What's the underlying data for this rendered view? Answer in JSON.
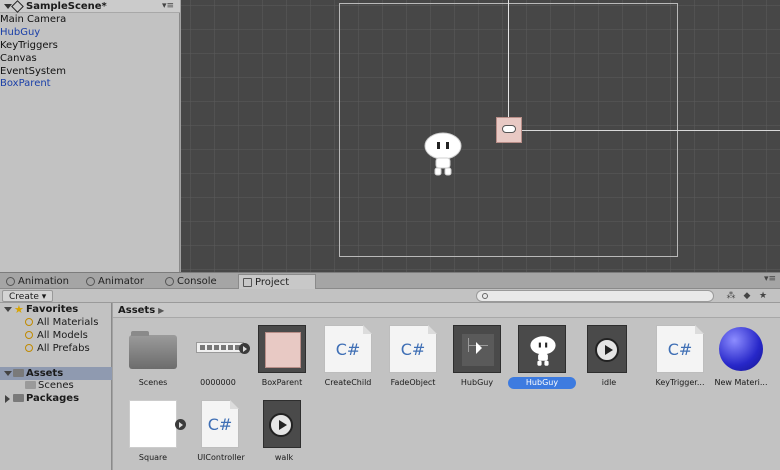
{
  "hierarchy": {
    "scene_name": "SampleScene*",
    "items": [
      {
        "label": "Main Camera",
        "prefab": false
      },
      {
        "label": "HubGuy",
        "prefab": true
      },
      {
        "label": "KeyTriggers",
        "prefab": false
      },
      {
        "label": "Canvas",
        "prefab": false,
        "collapsed": true
      },
      {
        "label": "EventSystem",
        "prefab": false
      },
      {
        "label": "BoxParent",
        "prefab": true
      }
    ]
  },
  "tabs": [
    {
      "label": "Animation",
      "icon": "animation-icon"
    },
    {
      "label": "Animator",
      "icon": "animator-icon"
    },
    {
      "label": "Console",
      "icon": "console-icon"
    },
    {
      "label": "Project",
      "icon": "project-folder-icon",
      "active": true
    }
  ],
  "toolbar": {
    "create_label": "Create",
    "search_value": ""
  },
  "project_sidebar": {
    "favorites_label": "Favorites",
    "favorites": [
      "All Materials",
      "All Models",
      "All Prefabs"
    ],
    "assets_label": "Assets",
    "assets_children": [
      "Scenes"
    ],
    "packages_label": "Packages"
  },
  "breadcrumb": "Assets",
  "assets": [
    {
      "label": "Scenes",
      "kind": "folder"
    },
    {
      "label": "0000000",
      "kind": "animation"
    },
    {
      "label": "BoxParent",
      "kind": "prefab-box"
    },
    {
      "label": "CreateChild",
      "kind": "script"
    },
    {
      "label": "FadeObject",
      "kind": "script"
    },
    {
      "label": "HubGuy",
      "kind": "screen"
    },
    {
      "label": "HubGuy",
      "kind": "sprite",
      "selected": true
    },
    {
      "label": "idle",
      "kind": "clip"
    },
    {
      "label": "KeyTrigger...",
      "kind": "script"
    },
    {
      "label": "New Materi...",
      "kind": "material"
    },
    {
      "label": "Square",
      "kind": "square"
    },
    {
      "label": "UIController",
      "kind": "script"
    },
    {
      "label": "walk",
      "kind": "clip"
    }
  ],
  "colors": {
    "selection": "#3d7be0",
    "prefab_text": "#1a3fa8",
    "scene_background": "#474747"
  }
}
